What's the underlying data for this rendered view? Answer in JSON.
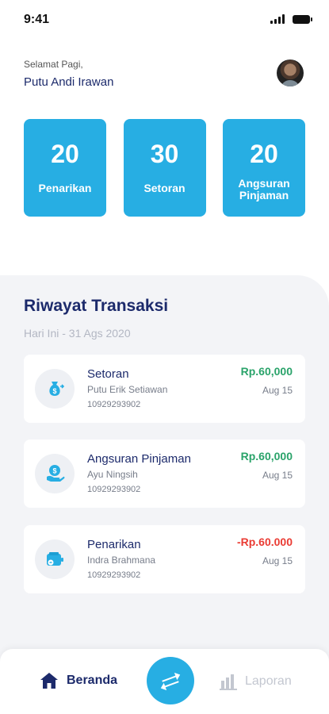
{
  "status": {
    "time": "9:41"
  },
  "header": {
    "greeting": "Selamat Pagi,",
    "user_name": "Putu Andi Irawan"
  },
  "stats": [
    {
      "value": "20",
      "label": "Penarikan"
    },
    {
      "value": "30",
      "label": "Setoran"
    },
    {
      "value": "20",
      "label": "Angsuran Pinjaman"
    }
  ],
  "history": {
    "title": "Riwayat Transaksi",
    "date_label": "Hari Ini - 31 Ags 2020",
    "transactions": [
      {
        "type": "Setoran",
        "person": "Putu Erik Setiawan",
        "ref": "10929293902",
        "amount": "Rp.60,000",
        "date": "Aug 15",
        "icon": "money-bag-icon"
      },
      {
        "type": "Angsuran Pinjaman",
        "person": "Ayu Ningsih",
        "ref": "10929293902",
        "amount": "Rp.60,000",
        "date": "Aug 15",
        "icon": "coin-hand-icon"
      },
      {
        "type": "Penarikan",
        "person": "Indra Brahmana",
        "ref": "10929293902",
        "amount": "-Rp.60.000",
        "date": "Aug 15",
        "icon": "wallet-icon"
      }
    ]
  },
  "nav": {
    "home_label": "Beranda",
    "report_label": "Laporan"
  },
  "colors": {
    "primary": "#27aee3",
    "navy": "#1c2a6b",
    "positive": "#2aa36a",
    "negative": "#ea3b33"
  }
}
